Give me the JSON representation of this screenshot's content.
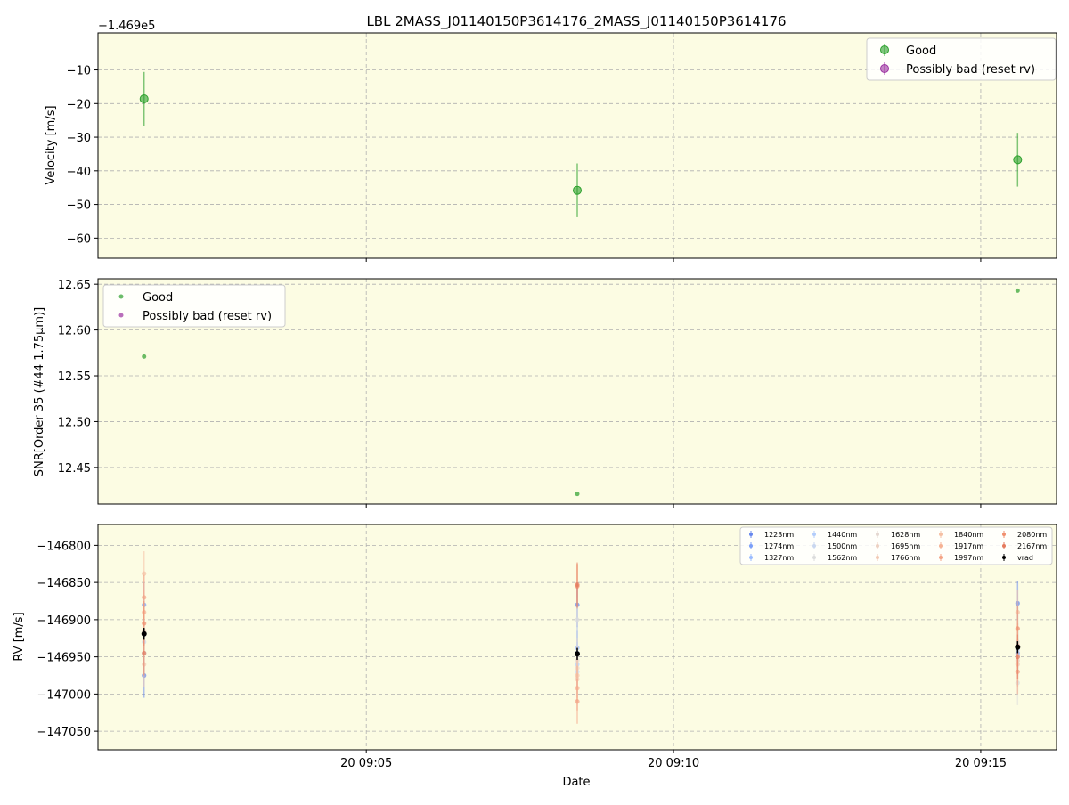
{
  "title": "LBL 2MASS_J01140150P3614176_2MASS_J01140150P3614176",
  "xlabel": "Date",
  "x_ticks": [
    "20 09:05",
    "20 09:10",
    "20 09:15"
  ],
  "chart_data": [
    {
      "type": "scatter",
      "panel": "velocity",
      "ylabel": "Velocity [m/s]",
      "offset_label": "−1.469e5",
      "y_ticks": [
        "−10",
        "−20",
        "−30",
        "−40",
        "−50",
        "−60"
      ],
      "ylim": [
        -66,
        1
      ],
      "legend_loc": "upper right",
      "series": [
        {
          "name": "Good",
          "color": "#2ca02c",
          "points": [
            {
              "x": "09:01:23",
              "y": -18.6,
              "err": 8.0
            },
            {
              "x": "09:08:26",
              "y": -45.8,
              "err": 8.0
            },
            {
              "x": "09:15:36",
              "y": -36.7,
              "err": 8.0
            }
          ]
        },
        {
          "name": "Possibly bad (reset rv)",
          "color": "#9b30a0",
          "points": []
        }
      ]
    },
    {
      "type": "scatter",
      "panel": "snr",
      "ylabel": "SNR[Order 35 (#44 1.75μm)]",
      "y_ticks": [
        "12.45",
        "12.50",
        "12.55",
        "12.60",
        "12.65"
      ],
      "ylim": [
        12.41,
        12.656
      ],
      "legend_loc": "upper left",
      "series": [
        {
          "name": "Good",
          "color": "#2ca02c",
          "points": [
            {
              "x": "09:01:23",
              "y": 12.571
            },
            {
              "x": "09:08:26",
              "y": 12.421
            },
            {
              "x": "09:15:36",
              "y": 12.643
            }
          ]
        },
        {
          "name": "Possibly bad (reset rv)",
          "color": "#9b30a0",
          "points": []
        }
      ]
    },
    {
      "type": "scatter",
      "panel": "rv",
      "ylabel": "RV [m/s]",
      "y_ticks": [
        "−146800",
        "−146850",
        "−146900",
        "−146950",
        "−147000",
        "−147050"
      ],
      "ylim": [
        -147075,
        -146772
      ],
      "legend_loc": "upper right",
      "x_times": [
        "09:01:23",
        "09:08:26",
        "09:15:36"
      ],
      "series": [
        {
          "name": "1223nm",
          "color": "#6788ee",
          "values": [
            -146975,
            -146880,
            -146878
          ],
          "err": [
            30,
            30,
            30
          ]
        },
        {
          "name": "1274nm",
          "color": "#7b9ff9",
          "values": [
            -146880,
            -146945,
            -146945
          ],
          "err": [
            30,
            30,
            30
          ]
        },
        {
          "name": "1327nm",
          "color": "#9abbff",
          "values": [
            -146920,
            -146938,
            -146935
          ],
          "err": [
            30,
            30,
            30
          ]
        },
        {
          "name": "1440nm",
          "color": "#b3cdfb",
          "values": [
            -146945,
            -146960,
            -146940
          ],
          "err": [
            30,
            30,
            30
          ]
        },
        {
          "name": "1500nm",
          "color": "#c9d7f0",
          "values": [
            -146930,
            -146970,
            -146950
          ],
          "err": [
            30,
            30,
            30
          ]
        },
        {
          "name": "1562nm",
          "color": "#dcdddd",
          "values": [
            -146945,
            -146900,
            -146985
          ],
          "err": [
            30,
            30,
            30
          ]
        },
        {
          "name": "1628nm",
          "color": "#e5d8d1",
          "values": [
            -146920,
            -146955,
            -146930
          ],
          "err": [
            30,
            30,
            30
          ]
        },
        {
          "name": "1695nm",
          "color": "#edd1c2",
          "values": [
            -146915,
            -146965,
            -146955
          ],
          "err": [
            30,
            30,
            30
          ]
        },
        {
          "name": "1766nm",
          "color": "#f2c9b4",
          "values": [
            -146960,
            -146980,
            -146960
          ],
          "err": [
            30,
            30,
            30
          ]
        },
        {
          "name": "1840nm",
          "color": "#f5c0a4",
          "values": [
            -146838,
            -146975,
            -146890
          ],
          "err": [
            30,
            30,
            30
          ]
        },
        {
          "name": "1917nm",
          "color": "#f6b294",
          "values": [
            -146890,
            -146992,
            -146935
          ],
          "err": [
            30,
            30,
            30
          ]
        },
        {
          "name": "1997nm",
          "color": "#f4a385",
          "values": [
            -146870,
            -147010,
            -146970
          ],
          "err": [
            30,
            30,
            30
          ]
        },
        {
          "name": "2080nm",
          "color": "#f08f6e",
          "values": [
            -146905,
            -146855,
            -146912
          ],
          "err": [
            30,
            30,
            30
          ]
        },
        {
          "name": "2167nm",
          "color": "#e57a5d",
          "values": [
            -146945,
            -146853,
            -146950
          ],
          "err": [
            30,
            30,
            30
          ]
        },
        {
          "name": "vrad",
          "color": "#000000",
          "values": [
            -146919,
            -146946,
            -146937
          ],
          "err": [
            8,
            8,
            8
          ]
        }
      ]
    }
  ]
}
